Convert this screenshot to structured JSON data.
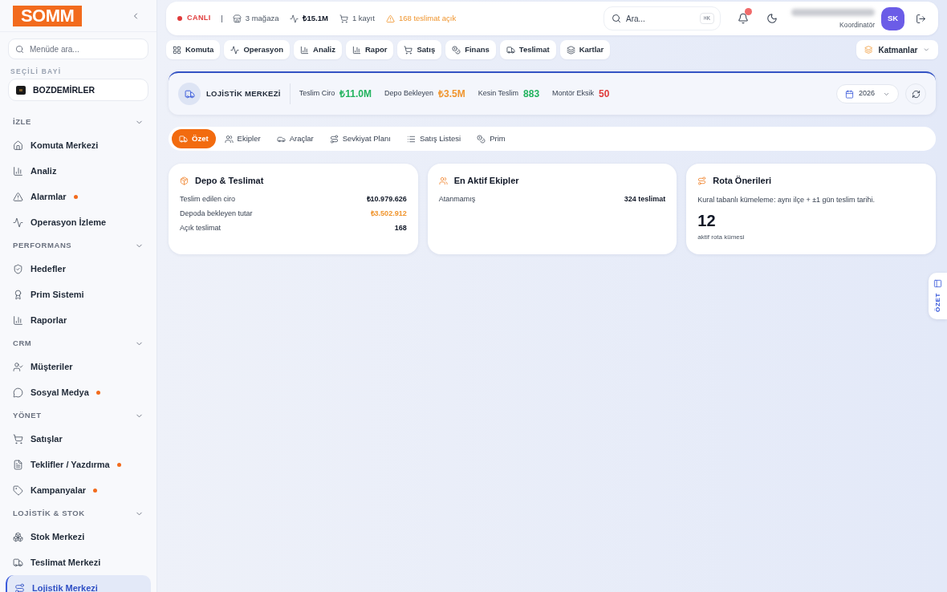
{
  "sidebar": {
    "logo": "SOMM",
    "search": {
      "placeholder": "Menüde ara..."
    },
    "dealer_label": "SEÇİLİ BAYİ",
    "dealer": "BOZDEMİRLER",
    "sections": [
      {
        "title": "İZLE",
        "expanded": true,
        "items": [
          {
            "label": "Komuta Merkezi",
            "dot": false,
            "selected": false
          },
          {
            "label": "Analiz",
            "dot": false,
            "selected": false
          },
          {
            "label": "Alarmlar",
            "dot": true,
            "selected": false
          },
          {
            "label": "Operasyon İzleme",
            "dot": false,
            "selected": false
          }
        ]
      },
      {
        "title": "PERFORMANS",
        "expanded": true,
        "items": [
          {
            "label": "Hedefler",
            "dot": false,
            "selected": false
          },
          {
            "label": "Prim Sistemi",
            "dot": false,
            "selected": false
          },
          {
            "label": "Raporlar",
            "dot": false,
            "selected": false
          }
        ]
      },
      {
        "title": "CRM",
        "expanded": true,
        "items": [
          {
            "label": "Müşteriler",
            "dot": false,
            "selected": false
          },
          {
            "label": "Sosyal Medya",
            "dot": true,
            "selected": false
          }
        ]
      },
      {
        "title": "YÖNET",
        "expanded": true,
        "items": [
          {
            "label": "Satışlar",
            "dot": false,
            "selected": false
          },
          {
            "label": "Teklifler / Yazdırma",
            "dot": true,
            "selected": false
          },
          {
            "label": "Kampanyalar",
            "dot": true,
            "selected": false
          }
        ]
      },
      {
        "title": "LOJİSTİK & STOK",
        "expanded": true,
        "items": [
          {
            "label": "Stok Merkezi",
            "dot": false,
            "selected": false
          },
          {
            "label": "Teslimat Merkezi",
            "dot": false,
            "selected": false
          },
          {
            "label": "Lojistik Merkezi",
            "dot": false,
            "selected": true
          }
        ]
      }
    ]
  },
  "top_bar": {
    "live": "CANLI",
    "stats": [
      {
        "text": "3 mağaza",
        "kind": "plain"
      },
      {
        "text": "₺15.1M",
        "kind": "bold"
      },
      {
        "text": "1 kayıt",
        "kind": "plain"
      },
      {
        "text": "168 teslimat açık",
        "kind": "warning"
      }
    ],
    "search": {
      "placeholder": "Ara...",
      "shortcut": "⌘K"
    },
    "notifications": {
      "unread": true
    },
    "user": {
      "role": "Koordinatör",
      "initials": "SK"
    }
  },
  "quick_nav": [
    {
      "label": "Komuta"
    },
    {
      "label": "Operasyon"
    },
    {
      "label": "Analiz"
    },
    {
      "label": "Rapor"
    },
    {
      "label": "Satış"
    },
    {
      "label": "Finans"
    },
    {
      "label": "Teslimat"
    },
    {
      "label": "Kartlar"
    }
  ],
  "layers_button": "Katmanlar",
  "module": {
    "title": "LOJİSTİK MERKEZİ",
    "kpis": [
      {
        "label": "Teslim Ciro",
        "value": "₺11.0M",
        "color": "#22b35e"
      },
      {
        "label": "Depo Bekleyen",
        "value": "₺3.5M",
        "color": "#f0952e"
      },
      {
        "label": "Kesin Teslim",
        "value": "883",
        "color": "#22b35e"
      },
      {
        "label": "Montör Eksik",
        "value": "50",
        "color": "#e03b3b"
      }
    ],
    "year": "2026"
  },
  "tabs": [
    {
      "label": "Özet",
      "selected": true
    },
    {
      "label": "Ekipler",
      "selected": false
    },
    {
      "label": "Araçlar",
      "selected": false
    },
    {
      "label": "Sevkiyat Planı",
      "selected": false
    },
    {
      "label": "Satış Listesi",
      "selected": false
    },
    {
      "label": "Prim",
      "selected": false
    }
  ],
  "cards": [
    {
      "kind": "list",
      "title": "Depo & Teslimat",
      "rows": [
        {
          "label": "Teslim edilen ciro",
          "value": "₺10.979.626",
          "color": "#111827"
        },
        {
          "label": "Depoda bekleyen tutar",
          "value": "₺3.502.912",
          "color": "#f0952e"
        },
        {
          "label": "Açık teslimat",
          "value": "168",
          "color": "#111827"
        }
      ]
    },
    {
      "kind": "list",
      "title": "En Aktif Ekipler",
      "rows": [
        {
          "label": "Atanmamış",
          "value": "324 teslimat",
          "color": "#111827"
        }
      ]
    },
    {
      "kind": "metric",
      "title": "Rota Önerileri",
      "description": "Kural tabanlı kümeleme: aynı ilçe + ±1 gün teslim tarihi.",
      "value": "12",
      "caption": "aktif rota kümesi"
    }
  ],
  "side_tab": "ÖZET"
}
